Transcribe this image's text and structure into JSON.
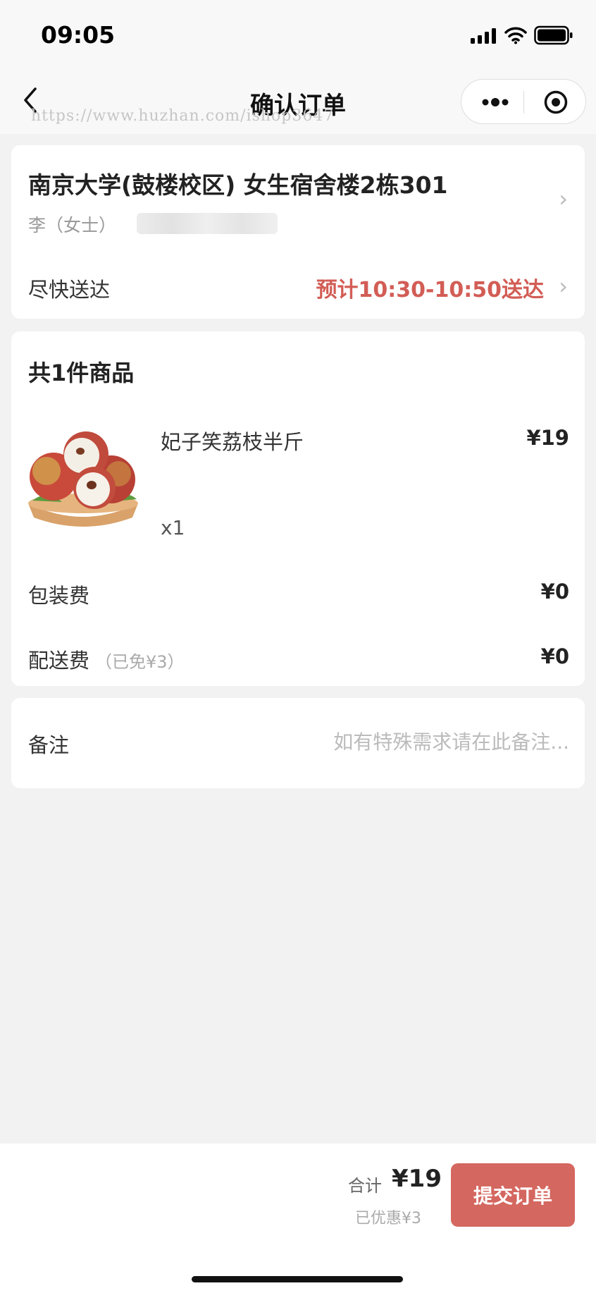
{
  "status_bar": {
    "time": "09:05"
  },
  "nav": {
    "title": "确认订单",
    "watermark": "https://www.huzhan.com/ishop3647"
  },
  "address": {
    "main": "南京大学(鼓楼校区) 女生宿舍楼2栋301",
    "contact": "李（女士）"
  },
  "delivery": {
    "label": "尽快送达",
    "time": "预计10:30-10:50送达"
  },
  "goods": {
    "title": "共1件商品",
    "item": {
      "name": "妃子笑荔枝半斤",
      "price": "¥19",
      "qty": "x1"
    }
  },
  "fees": {
    "packaging": {
      "label": "包装费",
      "value": "¥0"
    },
    "shipping": {
      "label": "配送费",
      "note": "（已免¥3）",
      "value": "¥0"
    }
  },
  "note": {
    "label": "备注",
    "placeholder": "如有特殊需求请在此备注..."
  },
  "footer": {
    "total_label": "合计",
    "total_value": "¥19",
    "discount": "已优惠¥3",
    "submit_label": "提交订单"
  },
  "colors": {
    "accent": "#d25d55",
    "button": "#d4675f",
    "background": "#f2f2f2"
  }
}
